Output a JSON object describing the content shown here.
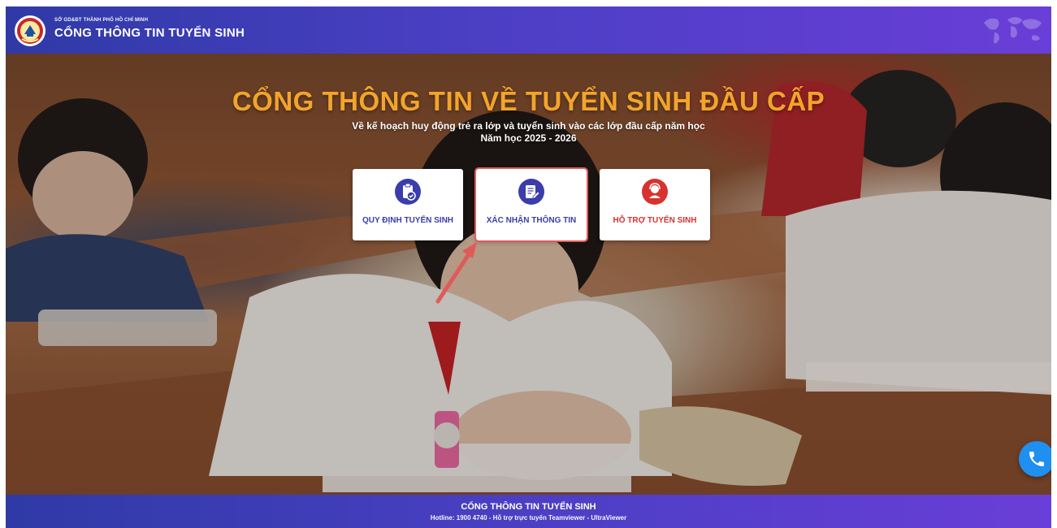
{
  "header": {
    "subtitle": "SỞ GD&ĐT THÀNH PHỐ HỒ CHÍ MINH",
    "title": "CỔNG THÔNG TIN TUYỂN SINH",
    "logo_icon": "school-seal-logo",
    "map_icon": "world-map-icon"
  },
  "hero": {
    "title": "CỔNG THÔNG TIN VỀ TUYỂN SINH ĐẦU CẤP",
    "description": "Về kế hoạch huy động trẻ ra lớp và tuyển sinh vào các lớp đầu cấp năm học",
    "school_year": "Năm học 2025 - 2026"
  },
  "cards": [
    {
      "label": "QUY ĐỊNH TUYỂN SINH",
      "icon": "clipboard-check-icon",
      "color": "#3a3daa"
    },
    {
      "label": "XÁC NHẬN THÔNG TIN",
      "icon": "document-edit-icon",
      "color": "#3a3daa"
    },
    {
      "label": "HỖ TRỢ TUYỂN SINH",
      "icon": "support-agent-icon",
      "color": "#d8322f"
    }
  ],
  "phone_button": {
    "icon": "phone-icon",
    "color": "#1f8ff0"
  },
  "footer": {
    "title": "CỔNG THÔNG TIN TUYỂN SINH",
    "hotline": "Hotline: 1900 4740 - Hỗ trợ trực tuyến Teamviewer - UltraViewer"
  },
  "colors": {
    "header_start": "#2f3aa6",
    "header_end": "#6a3ed8",
    "hero_title": "#f3a42a",
    "highlight_arrow": "#e05a5a"
  }
}
